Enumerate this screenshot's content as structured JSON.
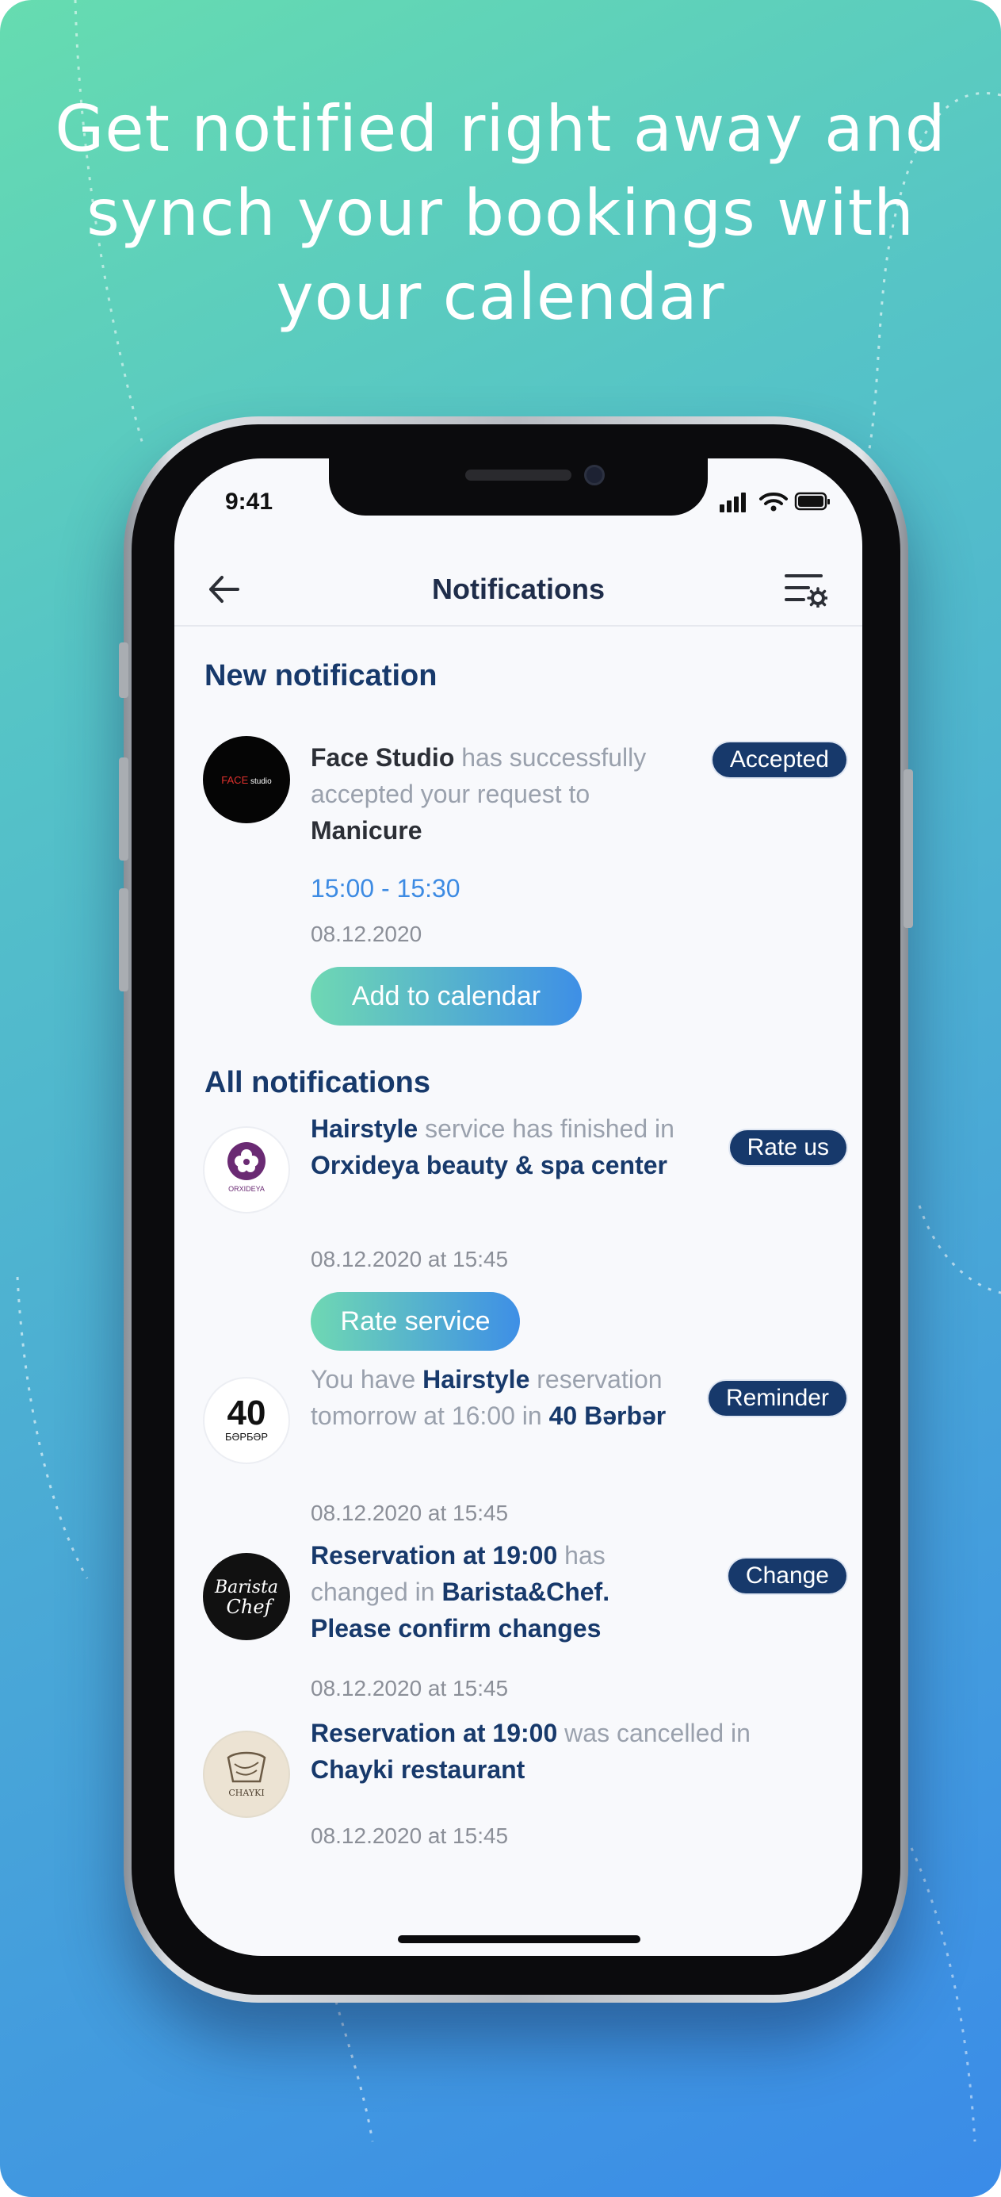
{
  "headline": {
    "line1": "Get notified right away and",
    "line2": "synch your bookings with",
    "line3": "your calendar"
  },
  "status_bar": {
    "time": "9:41",
    "icons": [
      "signal-icon",
      "wifi-icon",
      "battery-icon"
    ]
  },
  "nav": {
    "title": "Notifications",
    "back_icon": "arrow-left-icon",
    "filter_icon": "filter-settings-icon"
  },
  "new_section": {
    "title": "New notification",
    "item": {
      "avatar_text": "FACE studio",
      "salon": "Face Studio",
      "text_a": " has successfully accepted your request to ",
      "service": "Manicure",
      "badge": "Accepted",
      "time_range": "15:00 - 15:30",
      "date": "08.12.2020",
      "button": "Add to calendar"
    }
  },
  "all_section": {
    "title": "All notifications",
    "items": [
      {
        "avatar_text": "ORXIDEYA",
        "p1": "Hairstyle",
        "p2": " service has finished in ",
        "p3": "Orxideya beauty & spa center",
        "date": "08.12.2020 at 15:45",
        "badge": "Rate us",
        "button": "Rate service"
      },
      {
        "avatar_text_1": "40",
        "avatar_text_2": "БӘРБӘР",
        "p1": "You have ",
        "p2": "Hairstyle",
        "p3": " reservation tomorrow  at 16:00 in ",
        "p4": "40 Bərbər",
        "date": "08.12.2020 at 15:45",
        "badge": "Reminder"
      },
      {
        "avatar_text_1": "Barista",
        "avatar_text_2": "Chef",
        "p1": "Reservation at 19:00",
        "p2": " has changed in ",
        "p3": "Barista&Chef. Please confirm changes",
        "date": "08.12.2020 at 15:45",
        "badge": "Change"
      },
      {
        "avatar_text": "CHAYKI",
        "p1": "Reservation at 19:00",
        "p2": " was cancelled in ",
        "p3": "Chayki restaurant",
        "date": "08.12.2020 at 15:45"
      }
    ]
  },
  "colors": {
    "navy": "#17396b",
    "gradient_start": "#6fd8b3",
    "gradient_end": "#3e8fe6",
    "link_blue": "#3d8be3",
    "bg_top": "#66dcb0",
    "bg_bottom": "#3a8be8"
  }
}
